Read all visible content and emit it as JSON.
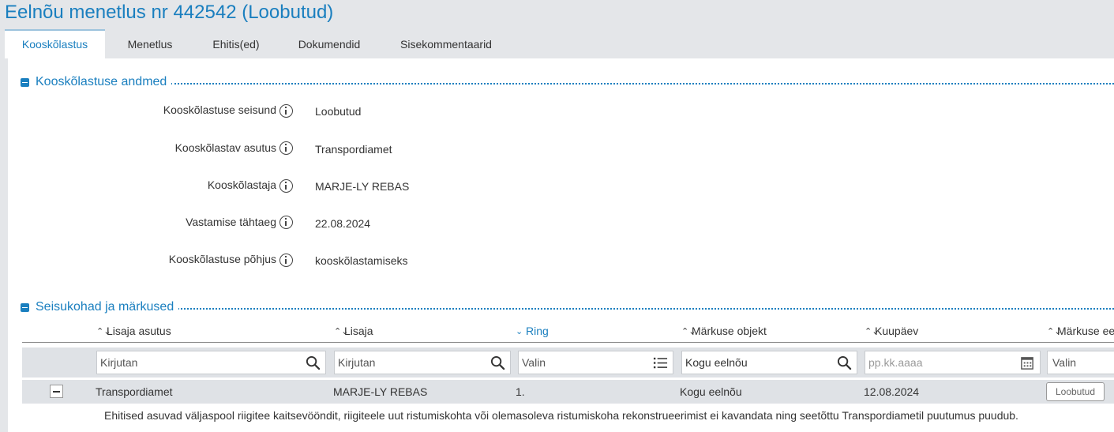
{
  "page": {
    "title": "Eelnõu menetlus nr 442542 (Loobutud)"
  },
  "tabs": [
    {
      "label": "Kooskõlastus",
      "active": true
    },
    {
      "label": "Menetlus"
    },
    {
      "label": "Ehitis(ed)"
    },
    {
      "label": "Dokumendid"
    },
    {
      "label": "Sisekommentaarid"
    }
  ],
  "approval_section": {
    "title": "Kooskõlastuse andmed",
    "fields": [
      {
        "label": "Kooskõlastuse seisund",
        "value": "Loobutud"
      },
      {
        "label": "Kooskõlastav asutus",
        "value": "Transpordiamet"
      },
      {
        "label": "Kooskõlastaja",
        "value": "MARJE-LY REBAS"
      },
      {
        "label": "Vastamise tähtaeg",
        "value": "22.08.2024"
      },
      {
        "label": "Kooskõlastuse põhjus",
        "value": "kooskõlastamiseks"
      }
    ]
  },
  "remarks_section": {
    "title": "Seisukohad ja märkused",
    "columns": [
      {
        "label": "Lisaja asutus",
        "sort_icon": "⌃⌄"
      },
      {
        "label": "Lisaja",
        "sort_icon": "⌃⌄"
      },
      {
        "label": "Ring",
        "sort_icon": "⌄",
        "active": true
      },
      {
        "label": "Märkuse objekt",
        "sort_icon": "⌃⌄"
      },
      {
        "label": "Kuupäev",
        "sort_icon": "⌃⌄"
      },
      {
        "label": "Märkuse ee",
        "sort_icon": "⌃⌄"
      }
    ],
    "filters": [
      {
        "placeholder": "Kirjutan",
        "icon": "search-icon"
      },
      {
        "placeholder": "Kirjutan",
        "icon": "search-icon"
      },
      {
        "placeholder": "Valin",
        "icon": "list-icon"
      },
      {
        "value": "Kogu eelnõu",
        "icon": "search-icon"
      },
      {
        "placeholder": "pp.kk.aaaa",
        "icon": "calendar-icon"
      },
      {
        "placeholder": "Valin"
      }
    ],
    "rows": [
      {
        "agency": "Transpordiamet",
        "author": "MARJE-LY REBAS",
        "round": "1.",
        "object": "Kogu eelnõu",
        "date": "12.08.2024",
        "status": "Loobutud",
        "comment": "Ehitised asuvad väljaspool riigitee kaitsevööndit, riigiteele uut ristumiskohta või olemasoleva ristumiskoha rekonstrueerimist ei kavandata ning seetõttu Transpordiametil puutumus puudub."
      }
    ]
  },
  "colors": {
    "accent": "#1a7fbf",
    "page_bg": "#e4e6e9",
    "filter_bg": "#dfe2e6"
  }
}
